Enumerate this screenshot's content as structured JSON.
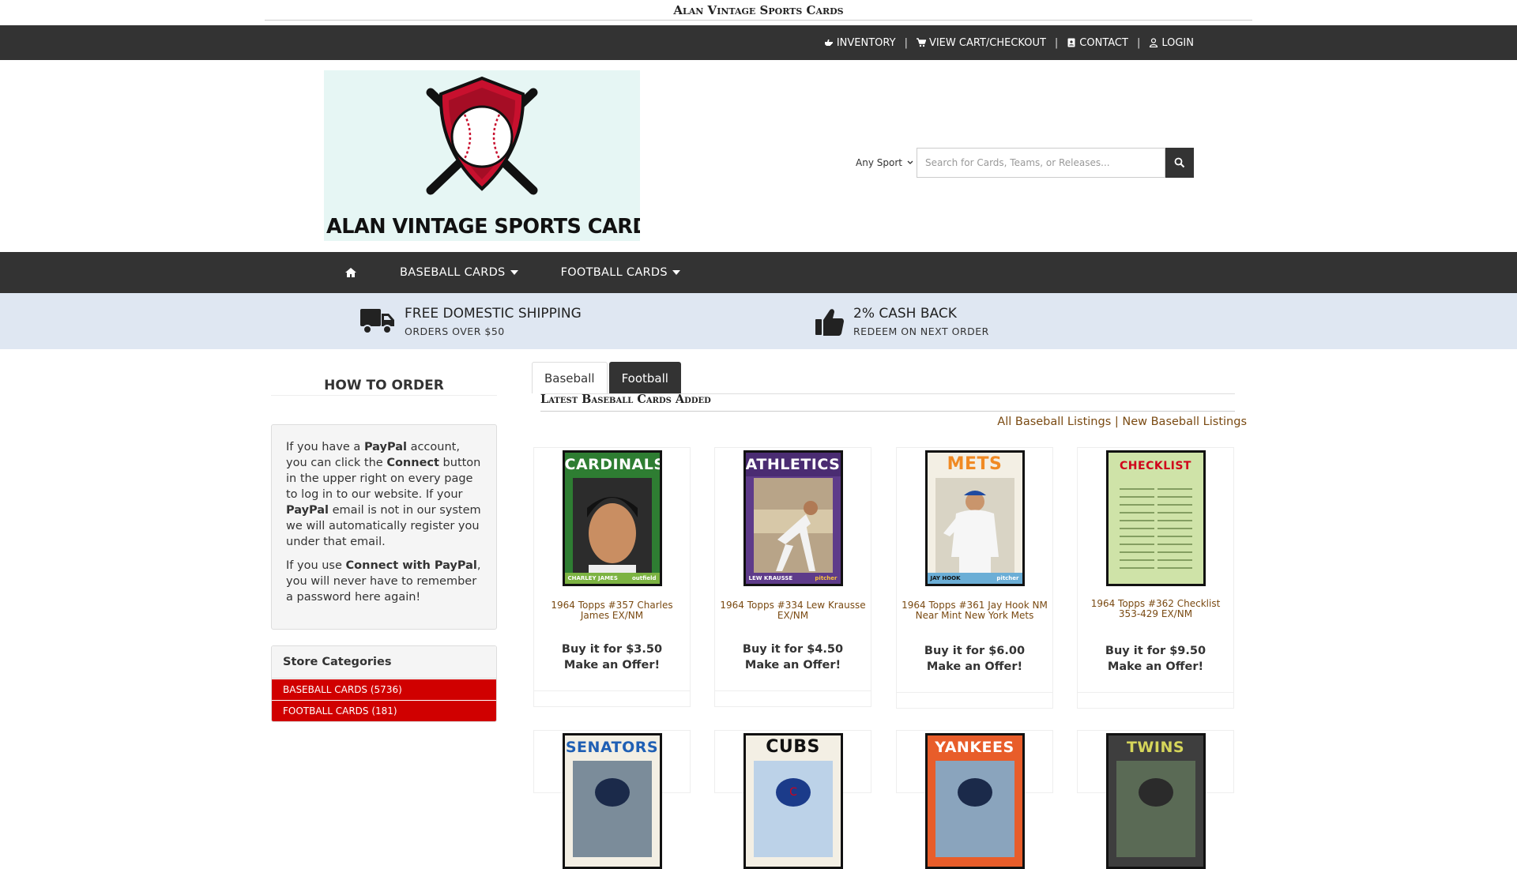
{
  "site": {
    "title": "Alan Vintage Sports Cards",
    "logo_text": "ALAN VINTAGE SPORTS CARDS"
  },
  "topnav": {
    "inventory": "INVENTORY",
    "cart": "VIEW CART/CHECKOUT",
    "contact": "CONTACT",
    "login": "LOGIN",
    "separator": "|"
  },
  "search": {
    "sport_value": "Any Sport",
    "placeholder": "Search for Cards, Teams, or Releases..."
  },
  "mainnav": {
    "baseball": "BASEBALL CARDS",
    "football": "FOOTBALL CARDS"
  },
  "promo": {
    "shipping_title": "FREE DOMESTIC SHIPPING",
    "shipping_sub": "ORDERS OVER $50",
    "cashback_title": "2% CASH BACK",
    "cashback_sub": "REDEEM ON NEXT ORDER"
  },
  "sidebar": {
    "how_to_order": "HOW TO ORDER",
    "p1_a": "If you have a ",
    "p1_b": "PayPal",
    "p1_c": " account, you can click the ",
    "p1_d": "Connect",
    "p1_e": " button in the upper right on every page to log in to our website. If your ",
    "p1_f": "PayPal",
    "p1_g": " email is not in our system we will automatically register you under that email.",
    "p2_a": "If you use ",
    "p2_b": "Connect with PayPal",
    "p2_c": ", you will never have to remember a password here again!",
    "categories_title": "Store Categories",
    "categories": [
      "BASEBALL CARDS (5736)",
      "FOOTBALL CARDS (181)"
    ]
  },
  "tabs": [
    "Baseball",
    "Football"
  ],
  "latest_heading": "Latest Baseball Cards Added",
  "listings": {
    "all": "All Baseball Listings",
    "sep": "|",
    "new": "New Baseball Listings"
  },
  "products": [
    {
      "team": "CARDINALS",
      "player": "CHARLEY JAMES",
      "position": "outfield",
      "name": "1964 Topps #357 Charles James EX/NM",
      "buy": "Buy it for $3.50",
      "offer": "Make an Offer!"
    },
    {
      "team": "ATHLETICS",
      "player": "LEW KRAUSSE",
      "position": "pitcher",
      "name": "1964 Topps #334 Lew Krausse EX/NM",
      "buy": "Buy it for $4.50",
      "offer": "Make an Offer!"
    },
    {
      "team": "METS",
      "player": "JAY HOOK",
      "position": "pitcher",
      "name": "1964 Topps #361 Jay Hook NM Near Mint New York Mets",
      "buy": "Buy it for $6.00",
      "offer": "Make an Offer!"
    },
    {
      "team": "CHECKLIST",
      "player": "",
      "position": "",
      "name": "1964 Topps #362 Checklist 353-429 EX/NM",
      "buy": "Buy it for $9.50",
      "offer": "Make an Offer!"
    }
  ],
  "products_row2": [
    "SENATORS",
    "CUBS",
    "YANKEES",
    "TWINS"
  ],
  "colors": {
    "bar": "#333333",
    "promo_bg": "#dfe7f2",
    "category_red": "#d00000",
    "link_brown": "#7a4a12"
  }
}
